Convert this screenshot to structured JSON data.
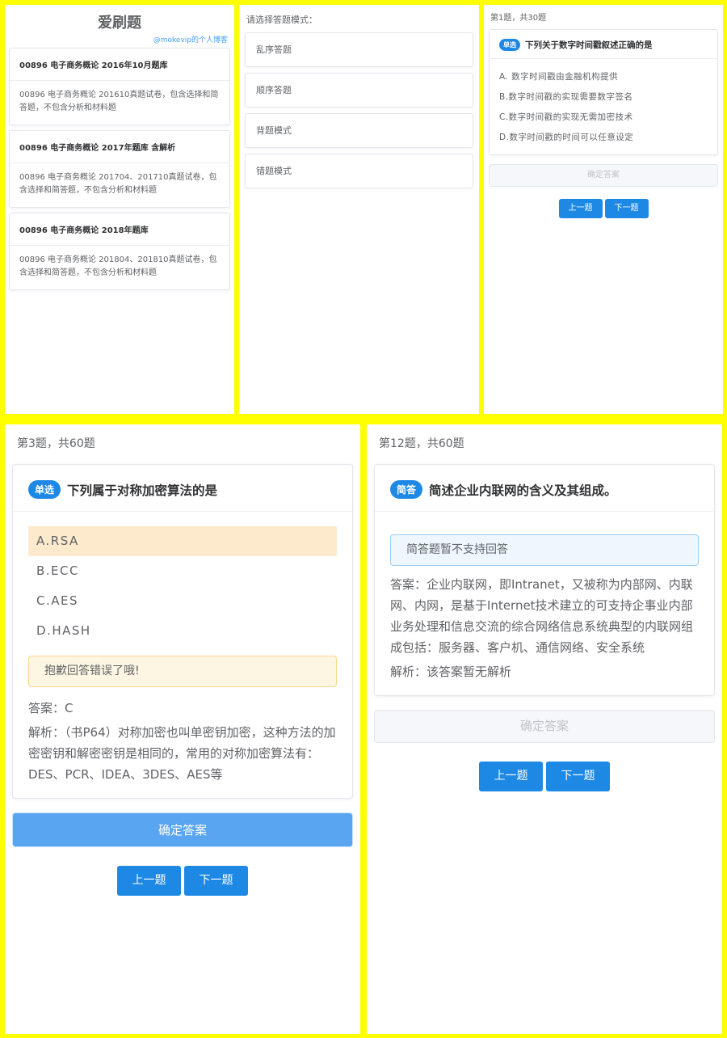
{
  "colors": {
    "background": "#ffff00",
    "accent": "#1e88e5",
    "selected_option": "#fde9cc",
    "warning": "#fdf6e2"
  },
  "bank_list": {
    "title": "爱刷题",
    "blog_link": "@mokevip的个人博客",
    "banks": [
      {
        "name": "00896 电子商务概论 2016年10月题库",
        "description": "00896 电子商务概论 201610真题试卷，包含选择和简答题，不包含分析和材料题"
      },
      {
        "name": "00896 电子商务概论 2017年题库 含解析",
        "description": "00896 电子商务概论 201704、201710真题试卷，包含选择和简答题，不包含分析和材料题"
      },
      {
        "name": "00896 电子商务概论 2018年题库",
        "description": "00896 电子商务概论 201804、201810真题试卷，包含选择和简答题，不包含分析和材料题"
      }
    ]
  },
  "mode_select": {
    "prompt": "请选择答题模式：",
    "modes": [
      "乱序答题",
      "顺序答题",
      "背题模式",
      "错题模式"
    ]
  },
  "quiz_small": {
    "counter": "第1题，共30题",
    "badge": "单选",
    "question": "下列关于数字时间戳叙述正确的是",
    "options": [
      "A. 数字时间戳由金融机构提供",
      "B.数字时间戳的实现需要数字签名",
      "C.数字时间戳的实现无需加密技术",
      "D.数字时间戳的时间可以任意设定"
    ],
    "confirm": "确定答案",
    "prev": "上一题",
    "next": "下一题"
  },
  "quiz_wrong": {
    "counter": "第3题，共60题",
    "badge": "单选",
    "question": "下列属于对称加密算法的是",
    "options": [
      "A.RSA",
      "B.ECC",
      "C.AES",
      "D.HASH"
    ],
    "selected_option": "A.RSA",
    "feedback": "抱歉回答错误了哦!",
    "answer": "答案：C",
    "analysis": "解析：（书P64）对称加密也叫单密钥加密，这种方法的加密密钥和解密密钥是相同的，常用的对称加密算法有：DES、PCR、IDEA、3DES、AES等",
    "confirm": "确定答案",
    "prev": "上一题",
    "next": "下一题"
  },
  "quiz_essay": {
    "counter": "第12题，共60题",
    "badge": "简答",
    "question": "简述企业内联网的含义及其组成。",
    "notice": "简答题暂不支持回答",
    "answer": "答案：企业内联网，即Intranet，又被称为内部网、内联网、内网，是基于Internet技术建立的可支持企事业内部业务处理和信息交流的综合网络信息系统典型的内联网组成包括：服务器、客户机、通信网络、安全系统",
    "analysis": "解析：该答案暂无解析",
    "confirm": "确定答案",
    "prev": "上一题",
    "next": "下一题"
  }
}
